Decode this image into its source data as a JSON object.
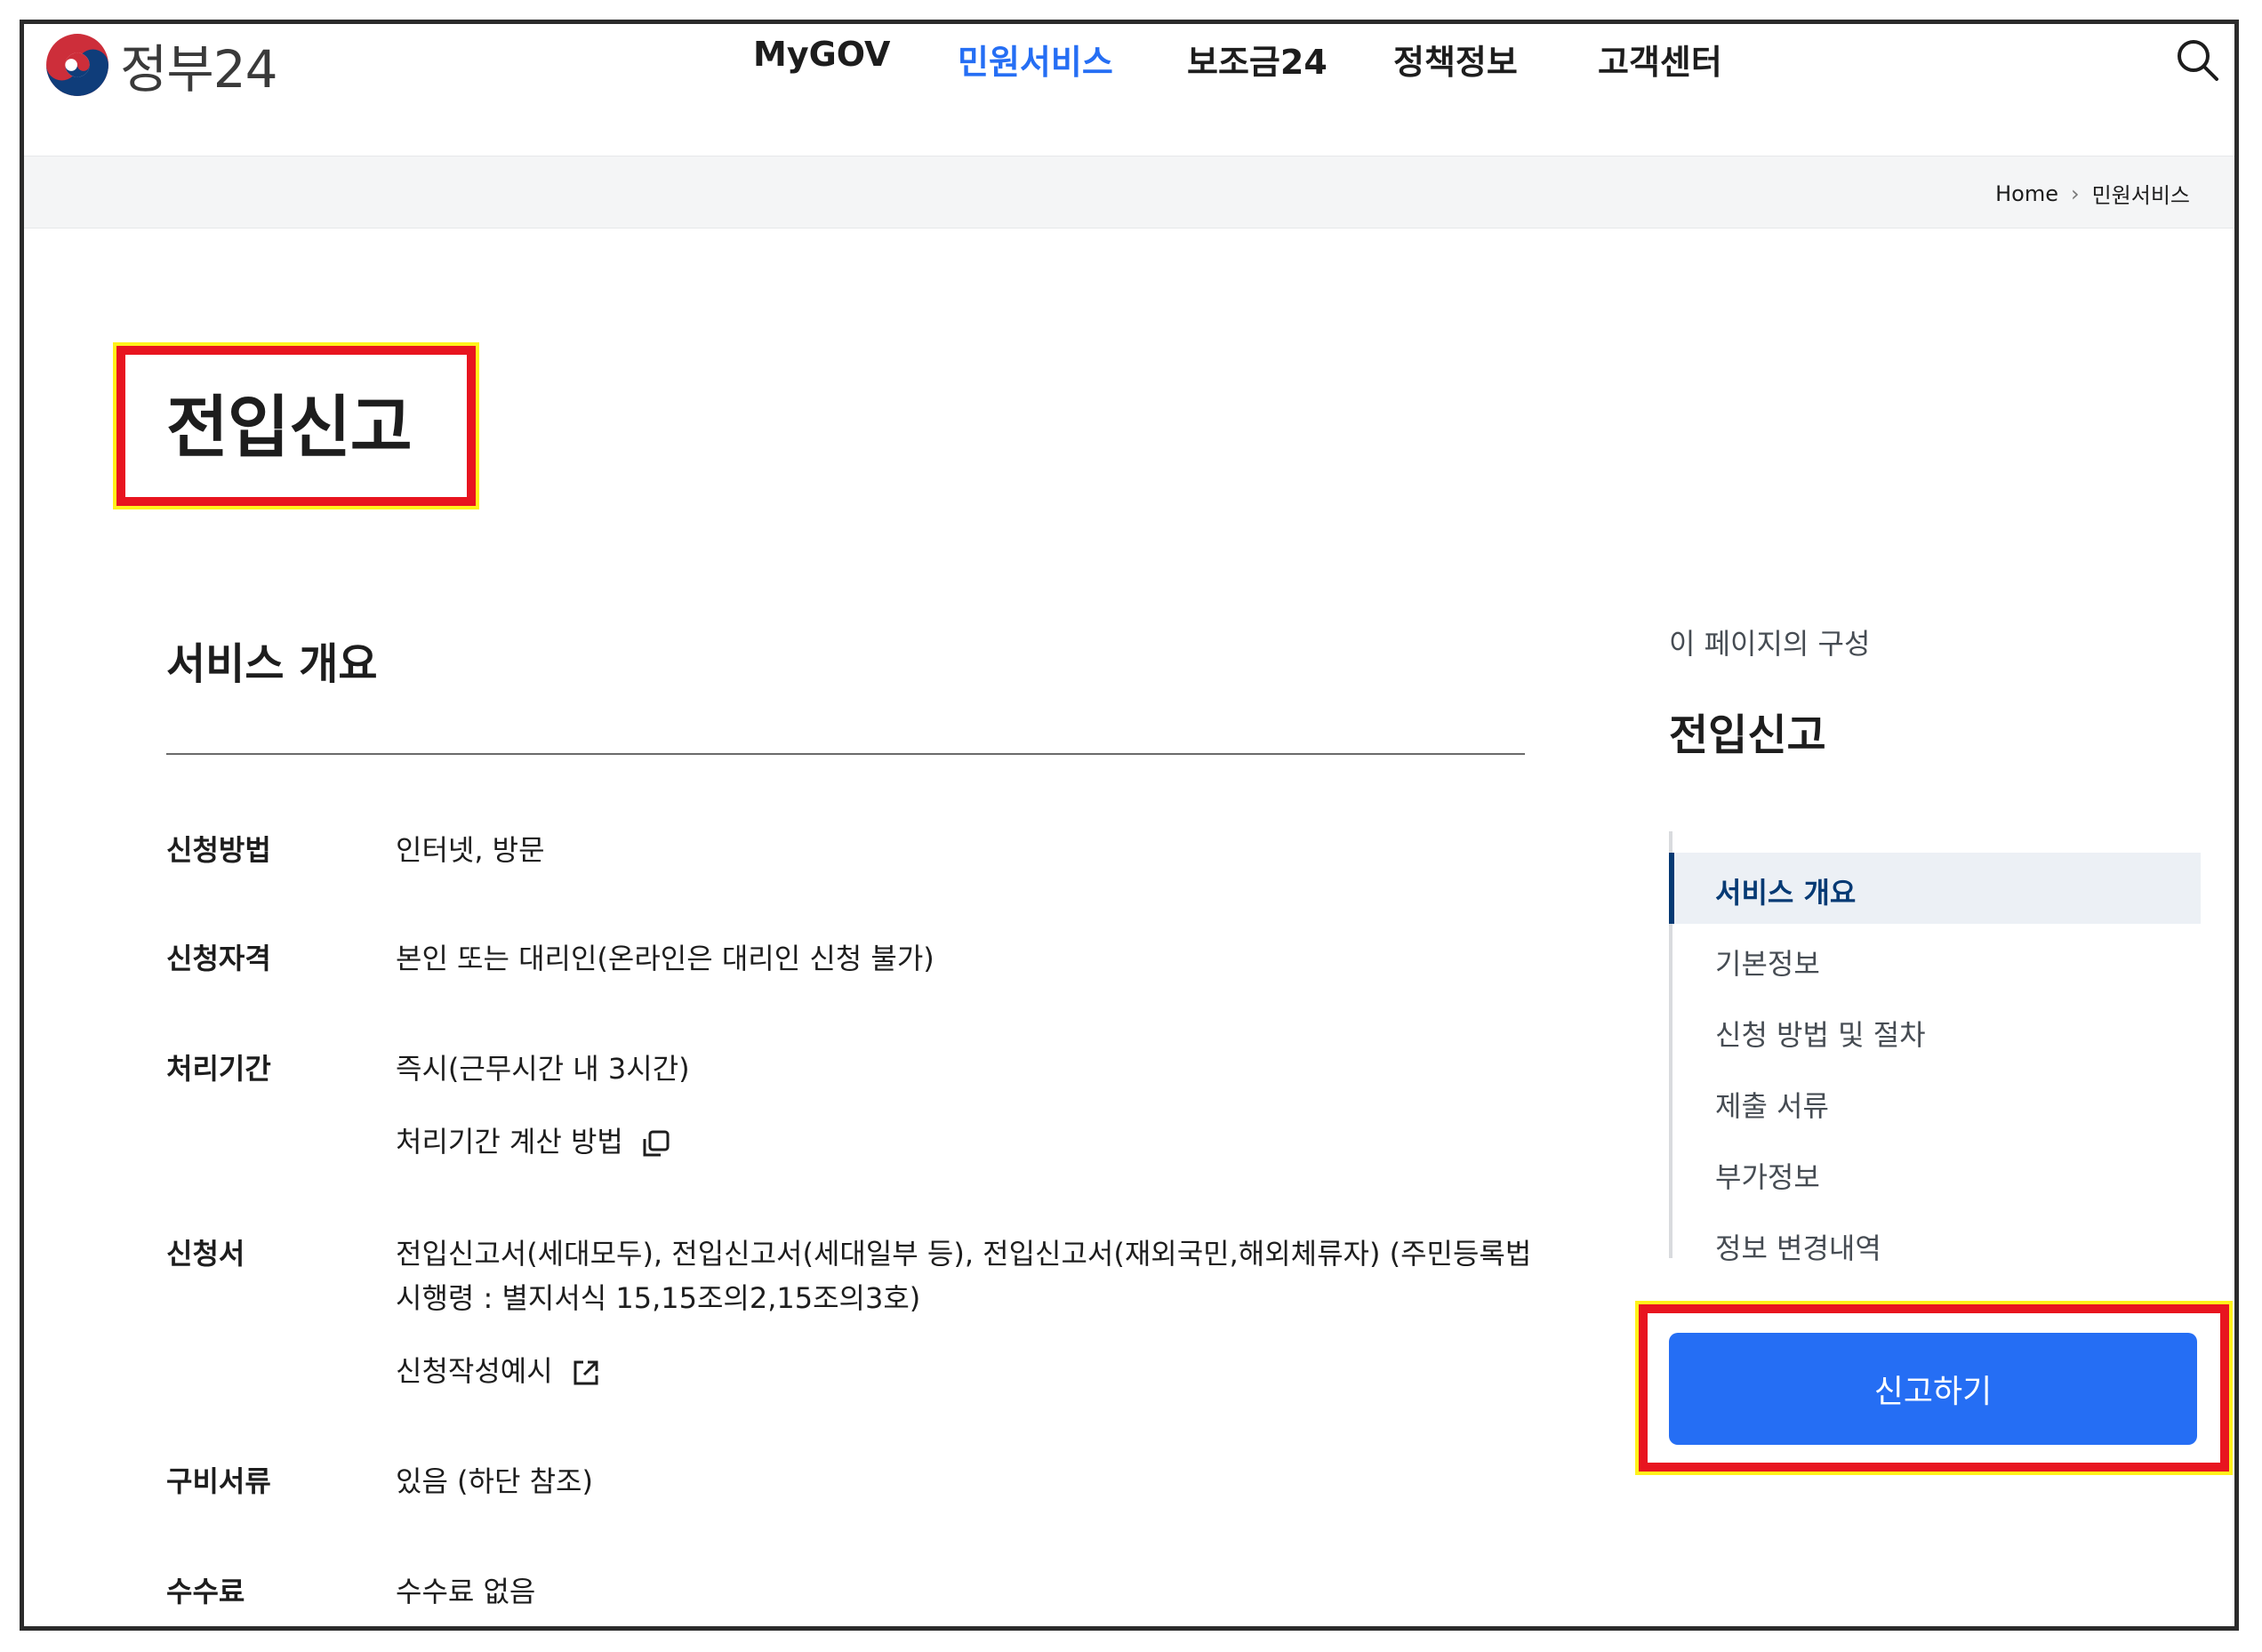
{
  "header": {
    "logo_text": "정부24",
    "nav": [
      {
        "label": "MyGOV",
        "active": false
      },
      {
        "label": "민원서비스",
        "active": true
      },
      {
        "label": "보조금24",
        "active": false
      },
      {
        "label": "정책정보",
        "active": false
      },
      {
        "label": "고객센터",
        "active": false
      }
    ],
    "search_icon": "search-icon"
  },
  "breadcrumb": {
    "home": "Home",
    "current": "민원서비스"
  },
  "page_title": "전입신고",
  "summary": {
    "title": "서비스 개요",
    "rows": [
      {
        "label": "신청방법",
        "value": "인터넷, 방문"
      },
      {
        "label": "신청자격",
        "value": "본인 또는 대리인(온라인은 대리인 신청 불가)"
      },
      {
        "label": "처리기간",
        "value": "즉시(근무시간 내 3시간)",
        "link": "처리기간 계산 방법"
      },
      {
        "label": "신청서",
        "value_line1": "전입신고서(세대모두), 전입신고서(세대일부 등), 전입신고서(재외국민,해외체류자) (주민등록법",
        "value_line2": "시행령 : 별지서식 15,15조의2,15조의3호)",
        "link": "신청작성예시"
      },
      {
        "label": "구비서류",
        "value": "있음 (하단 참조)"
      },
      {
        "label": "수수료",
        "value": "수수료 없음"
      }
    ]
  },
  "toc": {
    "caption": "이 페이지의 구성",
    "title": "전입신고",
    "items": [
      "서비스 개요",
      "기본정보",
      "신청 방법 및 절차",
      "제출 서류",
      "부가정보",
      "정보 변경내역"
    ]
  },
  "cta": {
    "label": "신고하기"
  },
  "colors": {
    "accent": "#256ef4",
    "highlight_border": "#e8141f",
    "highlight_outline": "#fff21a",
    "toc_active": "#063a74"
  }
}
